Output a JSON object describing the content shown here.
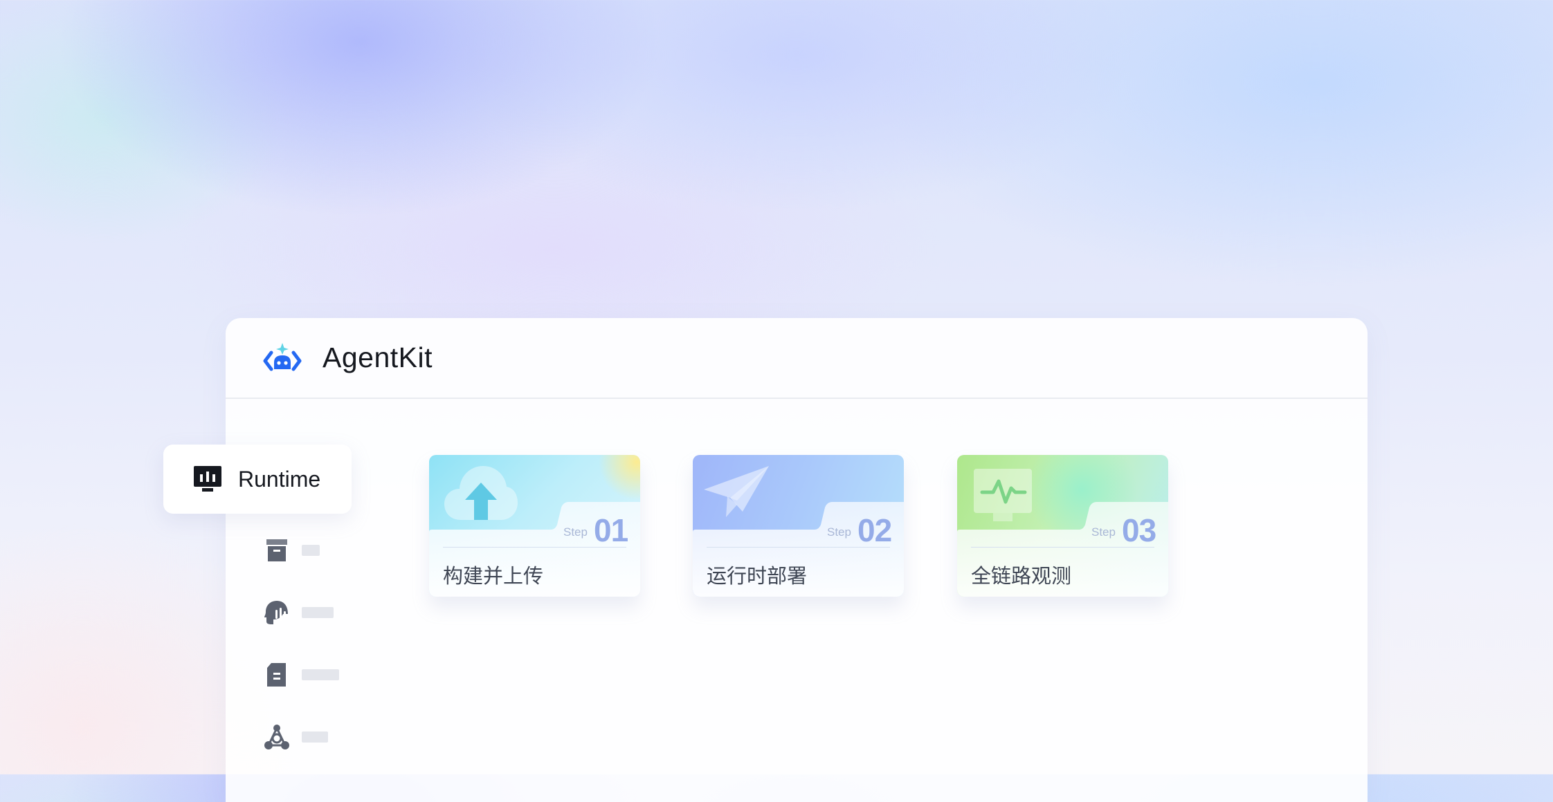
{
  "header": {
    "brand": "AgentKit",
    "logo_icon": "agentkit-logo-icon"
  },
  "sidebar": {
    "active_item": {
      "label": "Runtime",
      "icon": "runtime-monitor-icon"
    },
    "items": [
      {
        "icon": "archive-box-icon"
      },
      {
        "icon": "head-voice-icon"
      },
      {
        "icon": "document-icon"
      },
      {
        "icon": "network-nodes-icon"
      }
    ]
  },
  "steps": [
    {
      "step_label": "Step",
      "number": "01",
      "title": "构建并上传",
      "icon": "cloud-upload-icon"
    },
    {
      "step_label": "Step",
      "number": "02",
      "title": "运行时部署",
      "icon": "paper-plane-icon"
    },
    {
      "step_label": "Step",
      "number": "03",
      "title": "全链路观测",
      "icon": "monitor-pulse-icon"
    }
  ],
  "colors": {
    "brand_blue": "#2468f2",
    "logo_accent": "#5fd3e6",
    "nav_icon": "#5c6270",
    "step_number": "#94abe8"
  }
}
